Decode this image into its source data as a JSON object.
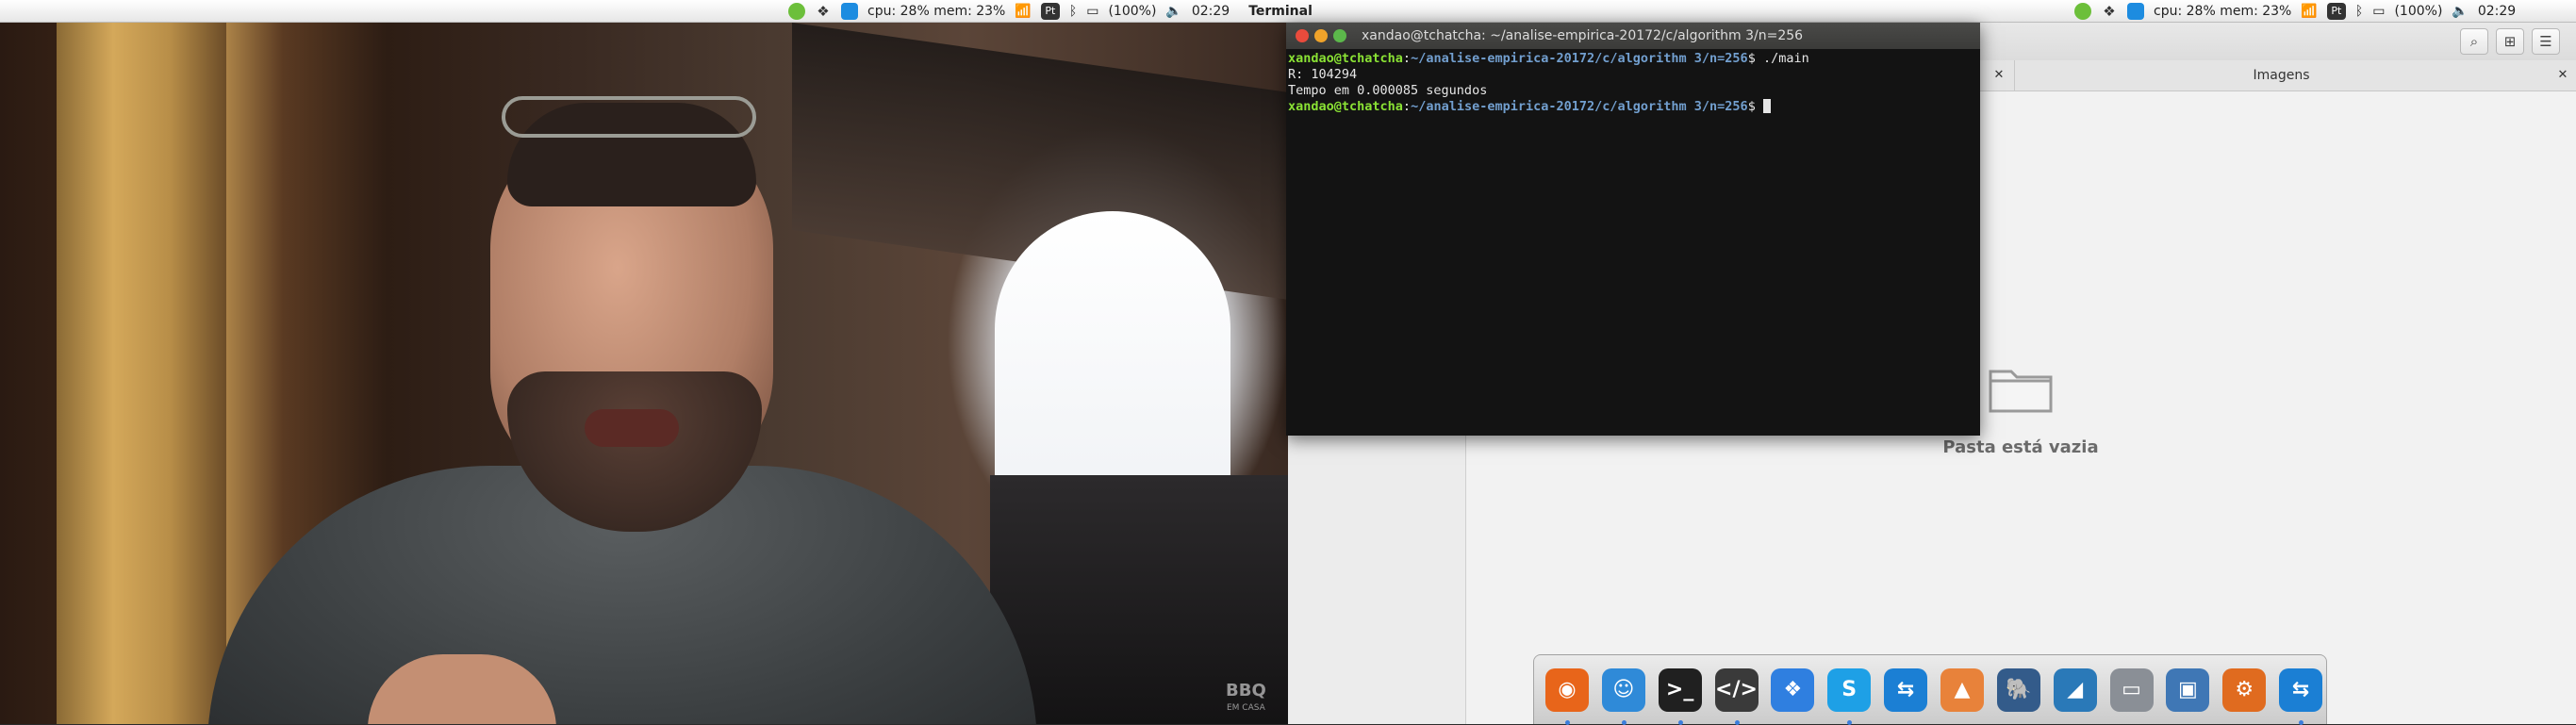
{
  "menubar": {
    "left_group": {
      "cpu_mem": "cpu: 28% mem: 23%",
      "keyboard": "Pt",
      "battery": "(100%)",
      "time": "02:29",
      "active_app": "Terminal"
    },
    "right_group": {
      "cpu_mem": "cpu: 28% mem: 23%",
      "keyboard": "Pt",
      "battery": "(100%)",
      "time": "02:29"
    }
  },
  "video": {
    "logo_main": "BBQ",
    "logo_sub": "EM CASA"
  },
  "file_manager": {
    "tabs": [
      {
        "label": ""
      },
      {
        "label": "Imagens"
      }
    ],
    "empty_message": "Pasta está vazia"
  },
  "terminal": {
    "title": "xandao@tchatcha: ~/analise-empirica-20172/c/algorithm 3/n=256",
    "lines": [
      {
        "user": "xandao@tchatcha",
        "path": "~/analise-empirica-20172/c/algorithm 3/n=256",
        "command": "./main"
      },
      {
        "output": "R: 104294"
      },
      {
        "output": "Tempo em 0.000085 segundos"
      },
      {
        "user": "xandao@tchatcha",
        "path": "~/analise-empirica-20172/c/algorithm 3/n=256",
        "command": ""
      }
    ]
  },
  "dock": {
    "items": [
      {
        "name": "firefox-icon",
        "color": "#e8651a",
        "glyph": "◉",
        "running": true
      },
      {
        "name": "finder-icon",
        "color": "#2f8ad8",
        "glyph": "☺",
        "running": true
      },
      {
        "name": "terminal-icon",
        "color": "#202020",
        "glyph": ">_",
        "running": true
      },
      {
        "name": "code-editor-icon",
        "color": "#3a3a3a",
        "glyph": "</>",
        "running": true
      },
      {
        "name": "dropbox-icon",
        "color": "#2f7fe0",
        "glyph": "❖",
        "running": false
      },
      {
        "name": "skype-icon",
        "color": "#1ea0e6",
        "glyph": "S",
        "running": true
      },
      {
        "name": "teamviewer-icon",
        "color": "#1b7fd4",
        "glyph": "⇆",
        "running": false
      },
      {
        "name": "matlab-icon",
        "color": "#e8823a",
        "glyph": "▲",
        "running": false
      },
      {
        "name": "postgresql-icon",
        "color": "#335b8a",
        "glyph": "🐘",
        "running": false
      },
      {
        "name": "mysql-workbench-icon",
        "color": "#2a79b8",
        "glyph": "◢",
        "running": false
      },
      {
        "name": "scanner-icon",
        "color": "#8a8f96",
        "glyph": "▭",
        "running": false
      },
      {
        "name": "virtualbox-icon",
        "color": "#3f77b5",
        "glyph": "▣",
        "running": false
      },
      {
        "name": "network-app-icon",
        "color": "#e06b1f",
        "glyph": "⚙",
        "running": false
      },
      {
        "name": "teamviewer2-icon",
        "color": "#1b7fd4",
        "glyph": "⇆",
        "running": true
      }
    ]
  }
}
